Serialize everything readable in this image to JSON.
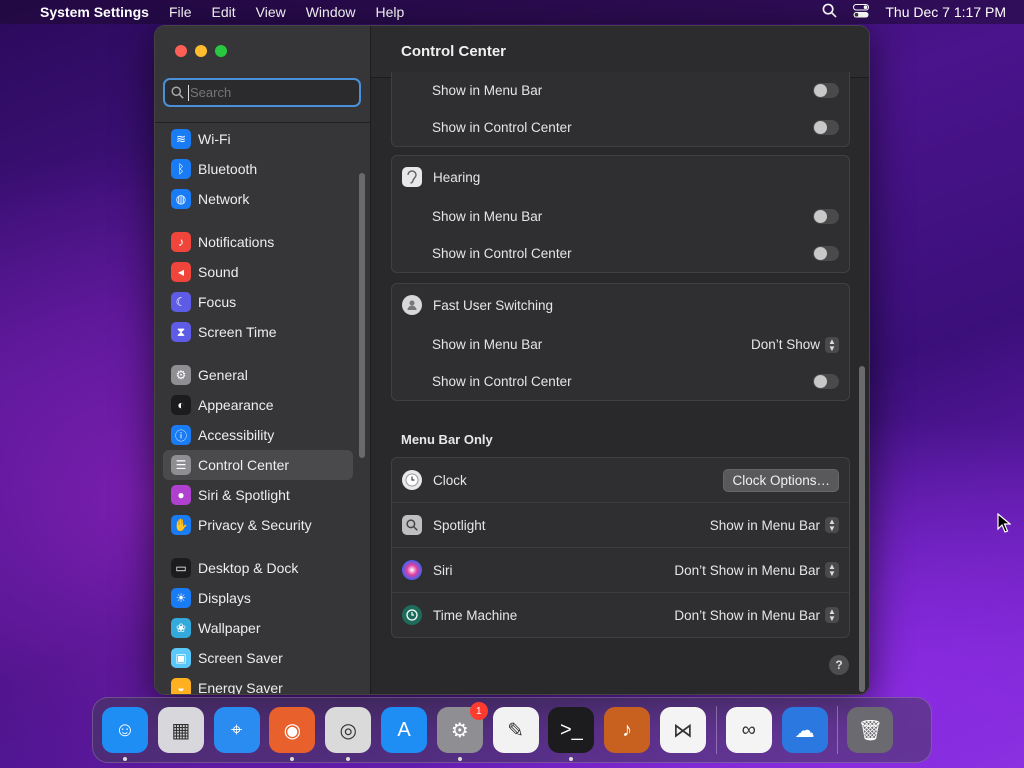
{
  "menubar": {
    "app_name": "System Settings",
    "menus": [
      "File",
      "Edit",
      "View",
      "Window",
      "Help"
    ],
    "clock": "Thu Dec 7  1:17 PM"
  },
  "sidebar": {
    "search_placeholder": "Search",
    "items": [
      {
        "label": "Wi-Fi",
        "icon": "wifi-icon",
        "color": "#1a7cf5"
      },
      {
        "label": "Bluetooth",
        "icon": "bluetooth-icon",
        "color": "#1a7cf5"
      },
      {
        "label": "Network",
        "icon": "globe-icon",
        "color": "#1a7cf5"
      },
      {
        "label": "Notifications",
        "icon": "bell-icon",
        "color": "#f0453a"
      },
      {
        "label": "Sound",
        "icon": "speaker-icon",
        "color": "#f0453a"
      },
      {
        "label": "Focus",
        "icon": "moon-icon",
        "color": "#5e5ce6"
      },
      {
        "label": "Screen Time",
        "icon": "hourglass-icon",
        "color": "#5e5ce6"
      },
      {
        "label": "General",
        "icon": "gear-icon",
        "color": "#8e8e93"
      },
      {
        "label": "Appearance",
        "icon": "appearance-icon",
        "color": "#1c1c1e"
      },
      {
        "label": "Accessibility",
        "icon": "accessibility-icon",
        "color": "#1a7cf5"
      },
      {
        "label": "Control Center",
        "icon": "control-center-icon",
        "color": "#8e8e93"
      },
      {
        "label": "Siri & Spotlight",
        "icon": "siri-icon",
        "color": "#b040d0"
      },
      {
        "label": "Privacy & Security",
        "icon": "hand-icon",
        "color": "#1a7cf5"
      },
      {
        "label": "Desktop & Dock",
        "icon": "dock-icon",
        "color": "#1c1c1e"
      },
      {
        "label": "Displays",
        "icon": "sun-icon",
        "color": "#1a7cf5"
      },
      {
        "label": "Wallpaper",
        "icon": "wallpaper-icon",
        "color": "#34aadc"
      },
      {
        "label": "Screen Saver",
        "icon": "screen-saver-icon",
        "color": "#5ac8fa"
      },
      {
        "label": "Energy Saver",
        "icon": "bulb-icon",
        "color": "#ffb020"
      }
    ],
    "selected": "Control Center"
  },
  "main": {
    "title": "Control Center",
    "partial_card": {
      "rows": [
        {
          "label": "Show in Menu Bar",
          "control": "toggle"
        },
        {
          "label": "Show in Control Center",
          "control": "toggle"
        }
      ]
    },
    "hearing": {
      "title": "Hearing",
      "rows": [
        {
          "label": "Show in Menu Bar",
          "control": "toggle"
        },
        {
          "label": "Show in Control Center",
          "control": "toggle"
        }
      ]
    },
    "fast_user": {
      "title": "Fast User Switching",
      "rows": [
        {
          "label": "Show in Menu Bar",
          "value": "Don’t Show"
        },
        {
          "label": "Show in Control Center",
          "control": "toggle"
        }
      ]
    },
    "menu_bar_only_label": "Menu Bar Only",
    "menu_bar_only": [
      {
        "label": "Clock",
        "button": "Clock Options…",
        "icon": "clock-icon"
      },
      {
        "label": "Spotlight",
        "value": "Show in Menu Bar",
        "icon": "magnifier-icon"
      },
      {
        "label": "Siri",
        "value": "Don’t Show in Menu Bar",
        "icon": "siri-icon"
      },
      {
        "label": "Time Machine",
        "value": "Don’t Show in Menu Bar",
        "icon": "time-machine-icon"
      }
    ],
    "help": "?"
  },
  "dock": {
    "apps": [
      {
        "name": "finder",
        "glyph": "☺",
        "color": "#1e8ef5",
        "running": true
      },
      {
        "name": "launchpad",
        "glyph": "▦",
        "color": "#d8d8dc",
        "running": false
      },
      {
        "name": "safari",
        "glyph": "⌖",
        "color": "#2a8cf0",
        "running": false
      },
      {
        "name": "firefox",
        "glyph": "◉",
        "color": "#e8602c",
        "running": true
      },
      {
        "name": "chrome",
        "glyph": "◎",
        "color": "#dadada",
        "running": true
      },
      {
        "name": "app-store",
        "glyph": "A",
        "color": "#1e8ef5",
        "running": false
      },
      {
        "name": "system-settings",
        "glyph": "⚙",
        "color": "#8e8e93",
        "running": true,
        "badge": "1"
      },
      {
        "name": "textedit",
        "glyph": "✎",
        "color": "#f2f2f2",
        "running": false
      },
      {
        "name": "terminal",
        "glyph": ">_",
        "color": "#1c1c1e",
        "running": true
      },
      {
        "name": "garageband",
        "glyph": "♪",
        "color": "#c86020",
        "running": false
      },
      {
        "name": "vscode",
        "glyph": "⋈",
        "color": "#f4f4f4",
        "running": false
      },
      {
        "name": "visual-studio",
        "glyph": "∞",
        "color": "#f4f4f4",
        "running": false
      },
      {
        "name": "weather",
        "glyph": "☁",
        "color": "#2a78e0",
        "running": false
      },
      {
        "name": "trash",
        "glyph": "🗑",
        "color": "#6a6a70",
        "running": false
      }
    ]
  }
}
